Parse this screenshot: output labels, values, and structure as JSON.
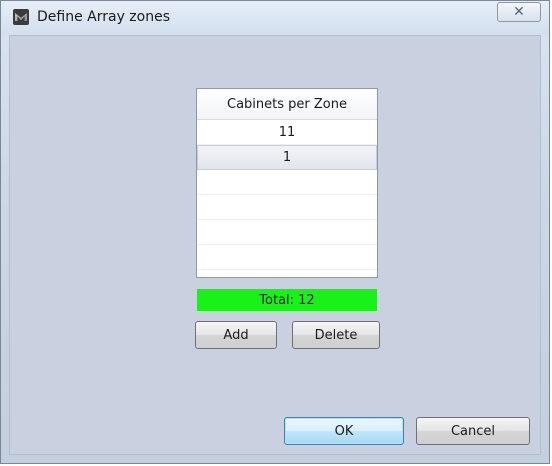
{
  "window": {
    "title": "Define Array zones",
    "close_glyph": "✕",
    "icon": "app-logo-icon"
  },
  "table": {
    "header": "Cabinets per Zone",
    "rows": [
      "11",
      "1",
      "",
      "",
      "",
      ""
    ],
    "selected_row": 1
  },
  "total": {
    "label": "Total: 12",
    "color": "#19f219"
  },
  "buttons": {
    "add": "Add",
    "delete": "Delete",
    "ok": "OK",
    "cancel": "Cancel"
  }
}
